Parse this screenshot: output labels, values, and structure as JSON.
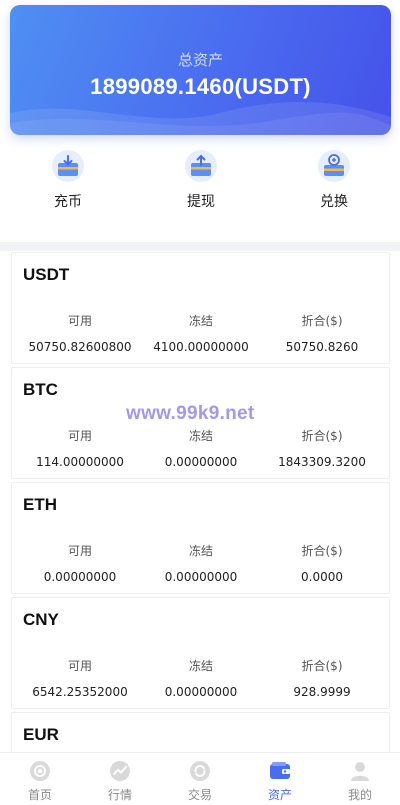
{
  "header": {
    "title": "总资产",
    "total": "1899089.1460(USDT)"
  },
  "actions": [
    {
      "label": "充币",
      "icon": "deposit-icon"
    },
    {
      "label": "提现",
      "icon": "withdraw-icon"
    },
    {
      "label": "兑换",
      "icon": "exchange-icon"
    }
  ],
  "columns": {
    "available": "可用",
    "frozen": "冻结",
    "converted": "折合($)"
  },
  "assets": [
    {
      "currency": "USDT",
      "available": "50750.82600800",
      "frozen": "4100.00000000",
      "converted": "50750.8260"
    },
    {
      "currency": "BTC",
      "available": "114.00000000",
      "frozen": "0.00000000",
      "converted": "1843309.3200"
    },
    {
      "currency": "ETH",
      "available": "0.00000000",
      "frozen": "0.00000000",
      "converted": "0.0000"
    },
    {
      "currency": "CNY",
      "available": "6542.25352000",
      "frozen": "0.00000000",
      "converted": "928.9999"
    },
    {
      "currency": "EUR"
    }
  ],
  "watermark": "www.99k9.net",
  "tabbar": [
    {
      "label": "首页",
      "icon": "home-icon"
    },
    {
      "label": "行情",
      "icon": "market-icon"
    },
    {
      "label": "交易",
      "icon": "trade-icon"
    },
    {
      "label": "资产",
      "icon": "wallet-icon",
      "active": true
    },
    {
      "label": "我的",
      "icon": "user-icon"
    }
  ],
  "colors": {
    "accent": "#4a6cf0",
    "hero_start": "#4f8ff2",
    "hero_end": "#4552e9",
    "tab_inactive": "#8a8a8a"
  }
}
